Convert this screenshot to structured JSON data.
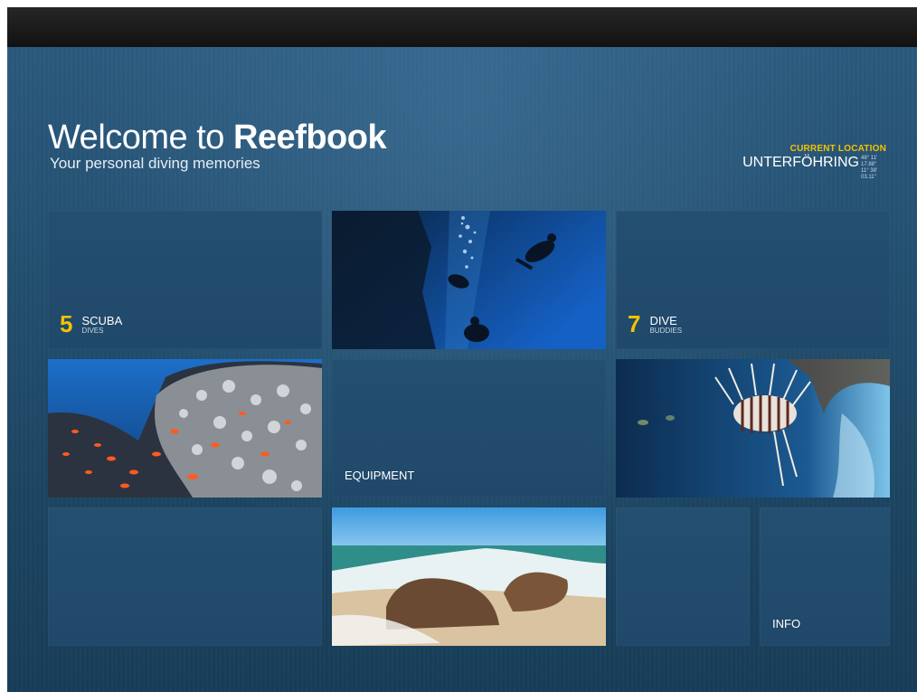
{
  "header": {
    "title_prefix": "Welcome to ",
    "title_brand": "Reefbook",
    "subtitle": "Your personal diving memories",
    "location_label": "CURRENT LOCATION",
    "location_name": "UNTERFÖHRING",
    "location_coords_1": "48° 11' 17.88\"",
    "location_coords_2": "11° 38' 03.11\""
  },
  "tiles": {
    "scuba": {
      "count": "5",
      "label": "SCUBA",
      "sublabel": "DIVES"
    },
    "buddies": {
      "count": "7",
      "label": "DIVE",
      "sublabel": "BUDDIES"
    },
    "equipment": {
      "label": "EQUIPMENT"
    },
    "info": {
      "label": "INFO"
    }
  },
  "colors": {
    "accent": "#f2c200",
    "background": "#1e4866",
    "tile": "#244f70"
  },
  "icons": {
    "divers_photo": "divers-underwater-photo",
    "coral_photo": "coral-reef-photo",
    "lionfish_photo": "lionfish-photo",
    "beach_photo": "beach-rocks-photo"
  }
}
